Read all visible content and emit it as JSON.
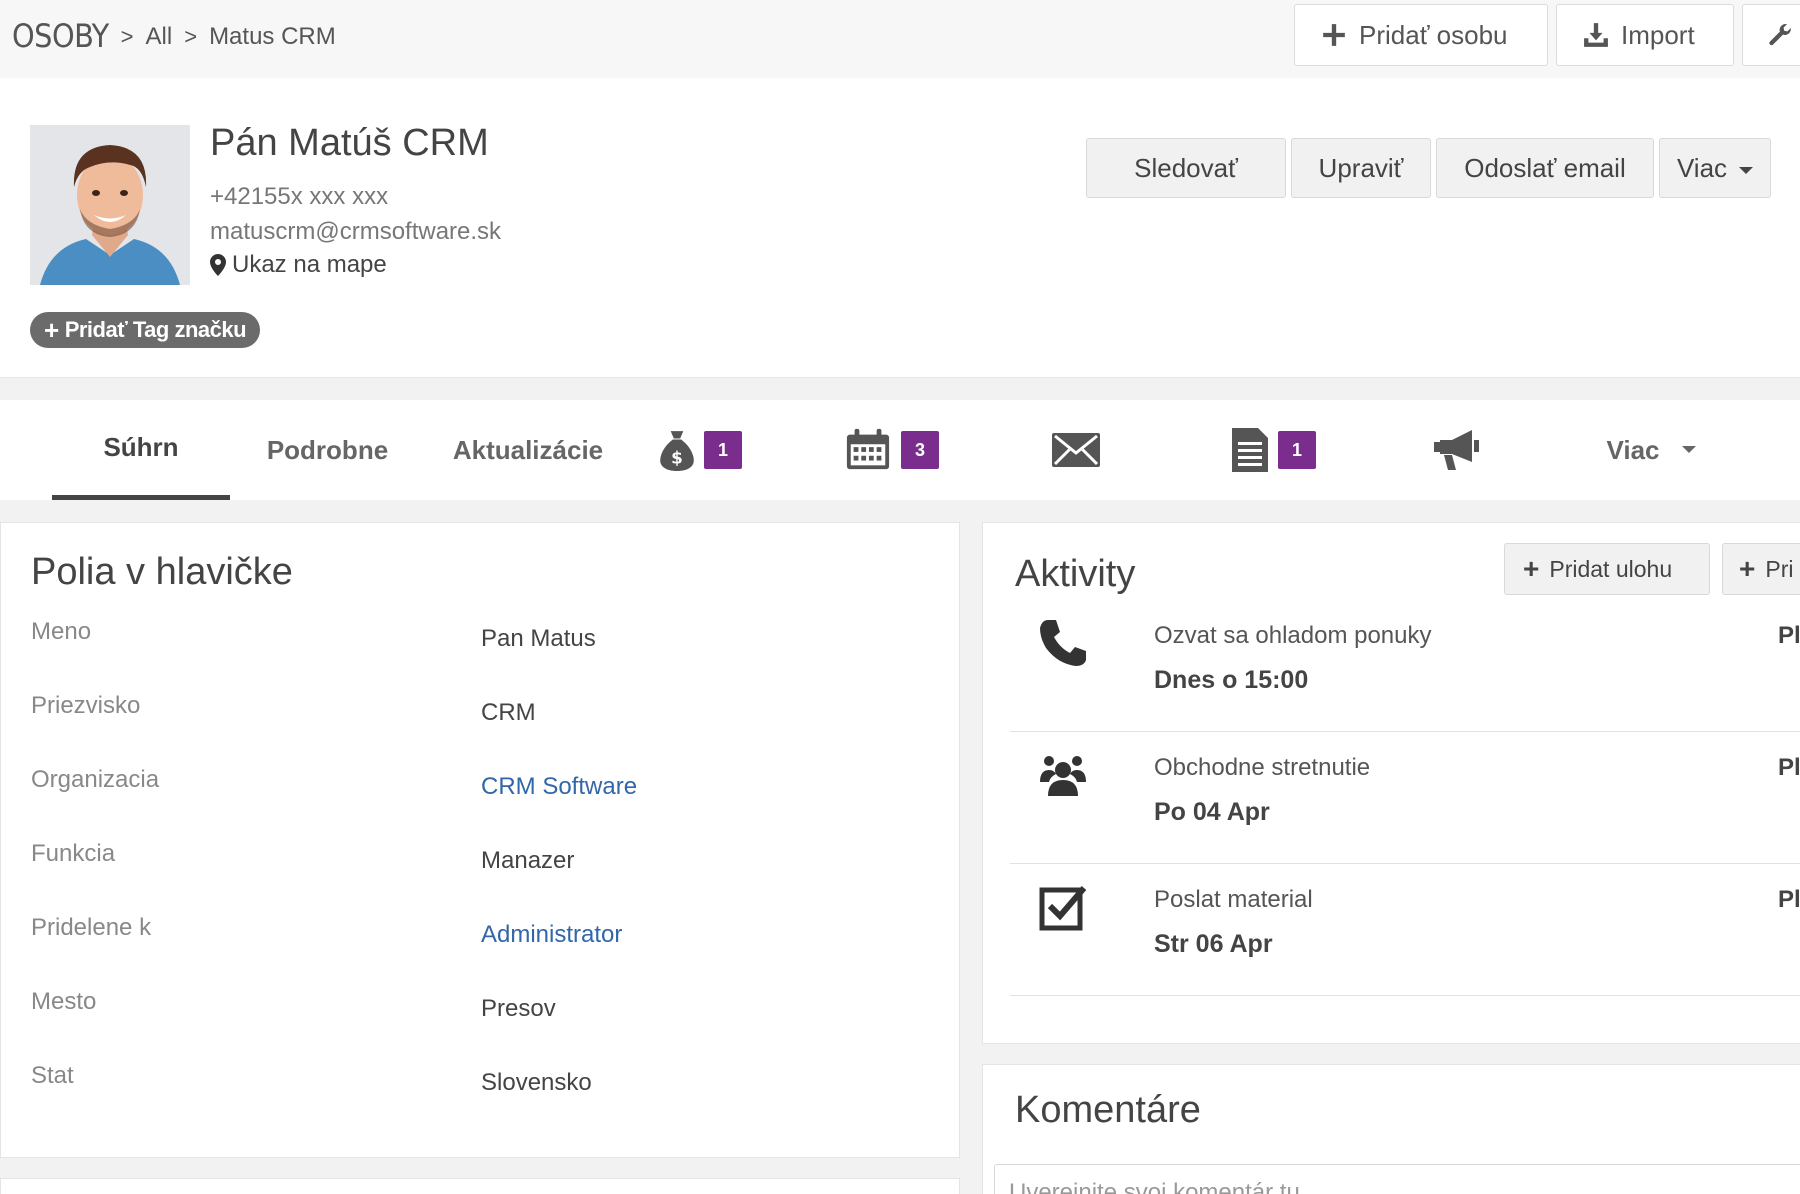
{
  "breadcrumb": {
    "module": "OSOBY",
    "all": "All",
    "current": "Matus CRM"
  },
  "top_actions": {
    "add_person": "Pridať osobu",
    "import": "Import",
    "tools": "F"
  },
  "profile": {
    "name": "Pán Matúš CRM",
    "phone": "+42155x xxx xxx",
    "email": "matuscrm@crmsoftware.sk",
    "map_link": "Ukaz na mape",
    "add_tag": "Pridať Tag značku",
    "actions": {
      "follow": "Sledovať",
      "edit": "Upraviť",
      "send_email": "Odoslať email",
      "more": "Viac"
    }
  },
  "tabs": {
    "summary": "Súhrn",
    "details": "Podrobne",
    "updates": "Aktualizácie",
    "deals_count": "1",
    "calendar_count": "3",
    "documents_count": "1",
    "more": "Viac"
  },
  "header_fields": {
    "title": "Polia v hlavičke",
    "rows": [
      {
        "label": "Meno",
        "value": "Pan Matus"
      },
      {
        "label": "Priezvisko",
        "value": "CRM"
      },
      {
        "label": "Organizacia",
        "value": "CRM Software"
      },
      {
        "label": "Funkcia",
        "value": "Manazer"
      },
      {
        "label": "Pridelene k",
        "value": "Administrator"
      },
      {
        "label": "Mesto",
        "value": "Presov"
      },
      {
        "label": "Stat",
        "value": "Slovensko"
      }
    ]
  },
  "activities": {
    "title": "Aktivity",
    "add_task": "Pridat ulohu",
    "add_event": "Pri",
    "items": [
      {
        "icon": "phone-icon",
        "title": "Ozvat sa ohladom ponuky",
        "date": "Dnes o 15:00",
        "side": "Pl"
      },
      {
        "icon": "meeting-icon",
        "title": "Obchodne stretnutie",
        "date": "Po 04 Apr",
        "side": "Pl"
      },
      {
        "icon": "checkbox-icon",
        "title": "Poslat material",
        "date": "Str 06 Apr",
        "side": "Pl"
      }
    ]
  },
  "comments": {
    "title": "Komentáre",
    "placeholder": "Uverejnite svoj komentár tu"
  },
  "colors": {
    "badge": "#7b2d8e",
    "link": "#3266a8",
    "tag_pill": "#6b6b6b"
  }
}
